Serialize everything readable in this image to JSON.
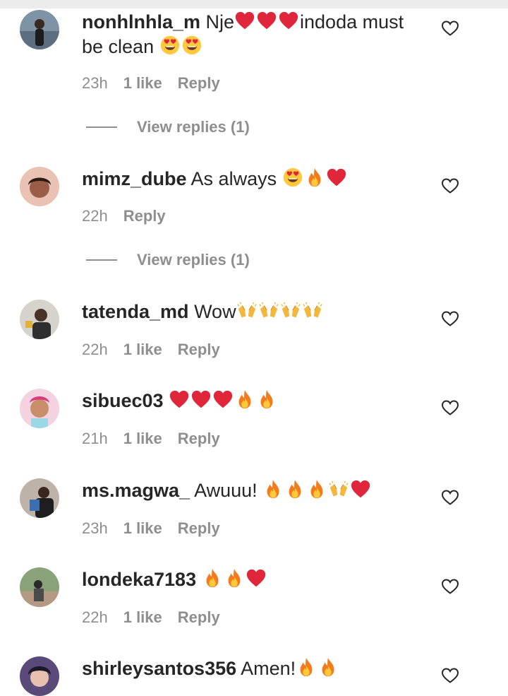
{
  "comments": [
    {
      "username": "nonhlnhla_m",
      "text": "Nje",
      "text2": "indoda must be clean",
      "time": "23h",
      "likes": "1 like",
      "reply": "Reply",
      "avatar_icon": "user-avatar-icon"
    },
    {
      "username": "mimz_dube",
      "text": "As always",
      "time": "22h",
      "reply": "Reply",
      "avatar_icon": "user-avatar-icon"
    },
    {
      "username": "tatenda_md",
      "text": "Wow",
      "time": "22h",
      "likes": "1 like",
      "reply": "Reply",
      "avatar_icon": "user-avatar-icon"
    },
    {
      "username": "sibuec03",
      "text": "",
      "time": "21h",
      "likes": "1 like",
      "reply": "Reply",
      "avatar_icon": "user-avatar-icon"
    },
    {
      "username": "ms.magwa_",
      "text": "Awuuu!",
      "time": "23h",
      "likes": "1 like",
      "reply": "Reply",
      "avatar_icon": "user-avatar-icon"
    },
    {
      "username": "londeka7183",
      "text": "",
      "time": "22h",
      "likes": "1 like",
      "reply": "Reply",
      "avatar_icon": "user-avatar-icon"
    },
    {
      "username": "shirleysantos356",
      "text": "Amen!",
      "avatar_icon": "user-avatar-icon"
    }
  ],
  "view_replies": [
    "View replies (1)",
    "View replies (1)"
  ],
  "colors": {
    "text": "#262626",
    "muted": "#8e8e8e",
    "heart_red": "#e0263b",
    "fire_orange": "#f47a1c"
  }
}
